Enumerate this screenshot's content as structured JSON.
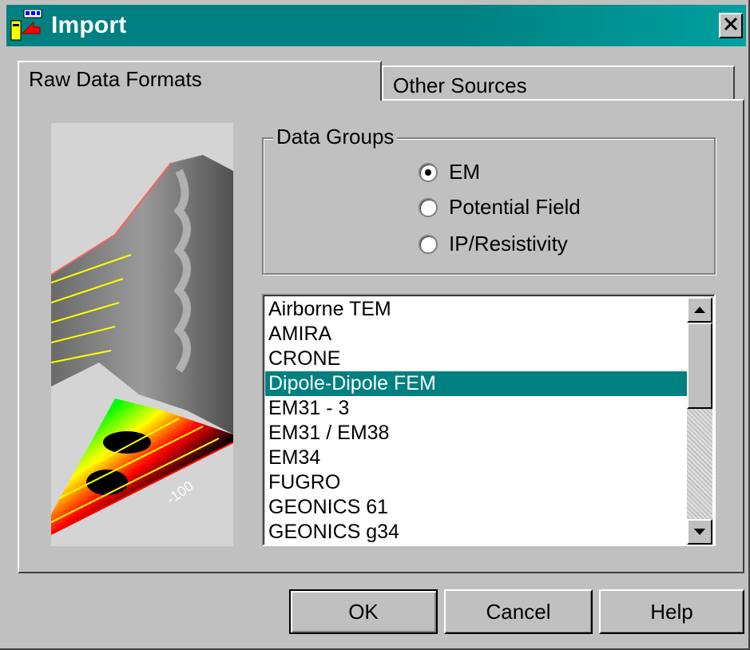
{
  "window": {
    "title": "Import",
    "title_icon": "import-app-icon",
    "close_icon": "close-icon",
    "title_color": "#008080"
  },
  "tabs": [
    {
      "label": "Raw Data Formats",
      "active": true
    },
    {
      "label": "Other Sources",
      "active": false
    }
  ],
  "data_groups": {
    "label": "Data Groups",
    "options": [
      {
        "label": "EM",
        "checked": true
      },
      {
        "label": "Potential Field",
        "checked": false
      },
      {
        "label": "IP/Resistivity",
        "checked": false
      }
    ]
  },
  "illustration": {
    "icon": "terrain-3d-illustration",
    "axis_label": "-100"
  },
  "format_list": {
    "items": [
      "Airborne TEM",
      "AMIRA",
      "CRONE",
      "Dipole-Dipole FEM",
      "EM31 - 3",
      "EM31 / EM38",
      "EM34",
      "FUGRO",
      "GEONICS 61",
      "GEONICS g34"
    ],
    "selected_index": 3,
    "selection_color": "#008080"
  },
  "buttons": {
    "ok": "OK",
    "cancel": "Cancel",
    "help": "Help"
  }
}
